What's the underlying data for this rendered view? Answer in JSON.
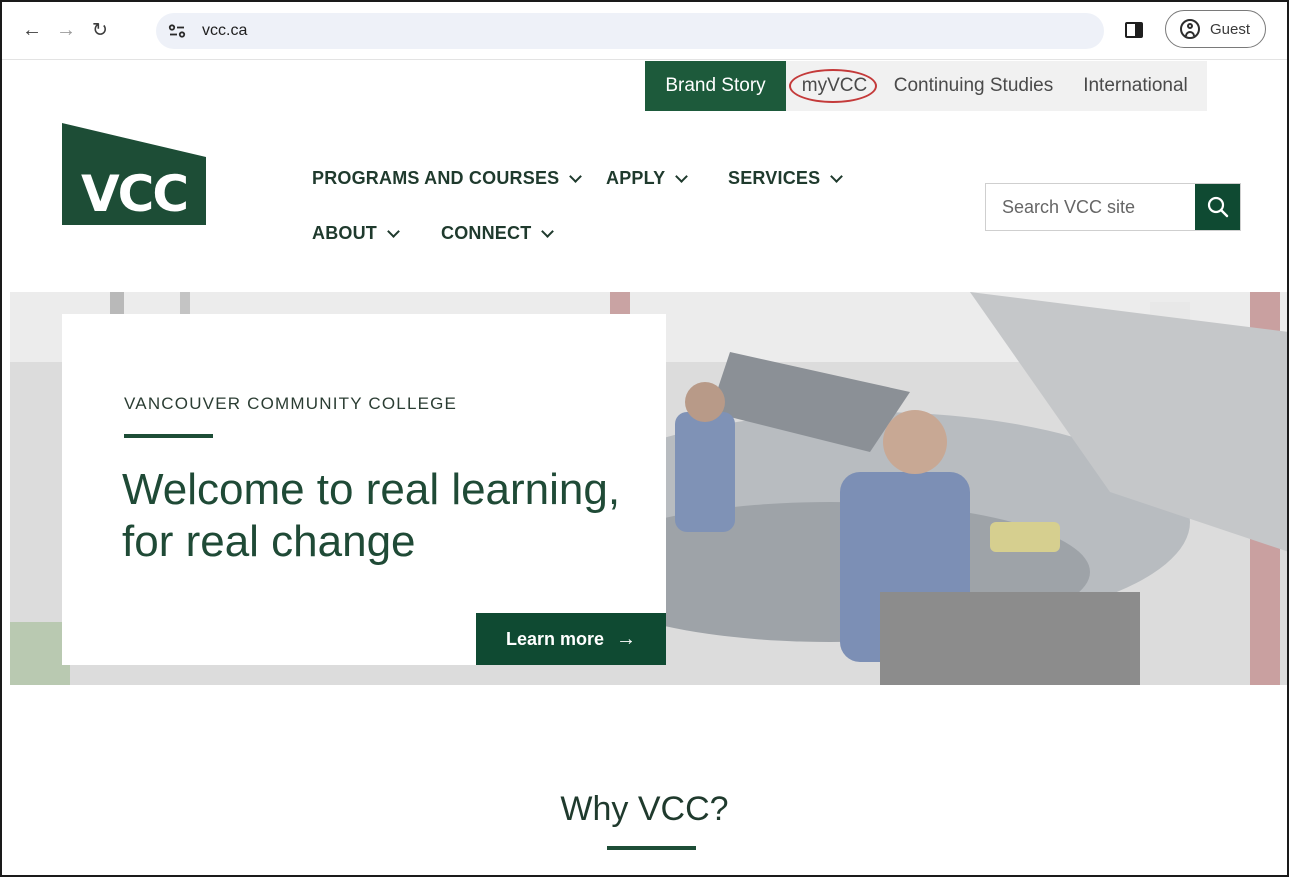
{
  "browser": {
    "url": "vcc.ca",
    "profile_label": "Guest"
  },
  "utility_nav": {
    "items": [
      "Brand Story",
      "myVCC",
      "Continuing Studies",
      "International"
    ]
  },
  "logo": {
    "text": "VCC"
  },
  "main_nav": {
    "items": [
      "PROGRAMS AND COURSES",
      "APPLY",
      "SERVICES",
      "ABOUT",
      "CONNECT"
    ]
  },
  "search": {
    "placeholder": "Search VCC site"
  },
  "hero": {
    "eyebrow": "VANCOUVER COMMUNITY COLLEGE",
    "title": "Welcome to real learning, for real change",
    "cta_label": "Learn more"
  },
  "why": {
    "title": "Why VCC?"
  },
  "colors": {
    "brand_green": "#1d5a3b",
    "dark_green": "#0f4a32",
    "annotation_red": "#c43a3a"
  }
}
